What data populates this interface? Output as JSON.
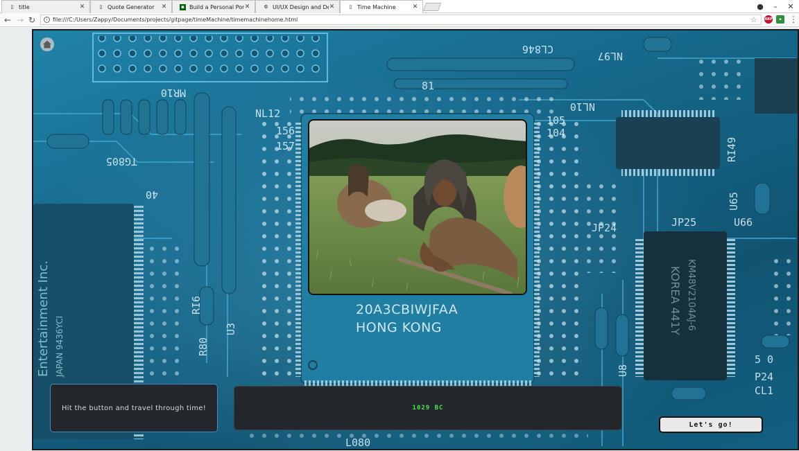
{
  "browser": {
    "tabs": [
      {
        "label": "title",
        "icon": "page-icon"
      },
      {
        "label": "Quote Generator",
        "icon": "page-icon"
      },
      {
        "label": "Build a Personal Portfolio",
        "icon": "freecodecamp-icon"
      },
      {
        "label": "UI/UX Design and Develo",
        "icon": "gear-icon"
      },
      {
        "label": "Time Machine",
        "icon": "page-icon"
      }
    ],
    "url": "file:///C:/Users/Zappy/Documents/projects/gitpage/timeMachine/timemachinehome.html",
    "extensions": [
      "abp-icon",
      "extension-green-icon"
    ]
  },
  "page": {
    "chip_line1": "20A3CBIWJFAA",
    "chip_line2": "HONG KONG",
    "message": "Hit the button and travel through time!",
    "year": "1029 BC",
    "go_button": "Let's go!"
  },
  "colors": {
    "accent_border": "#4a86c8",
    "year_text": "#47e64f",
    "panel_bg": "#23262b"
  }
}
